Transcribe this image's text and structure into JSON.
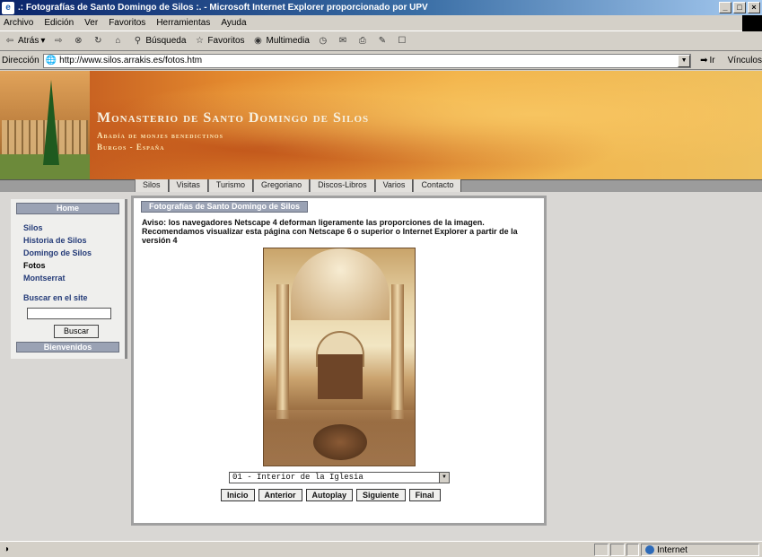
{
  "window": {
    "title": ".: Fotografías de Santo Domingo de Silos :. - Microsoft Internet Explorer proporcionado por UPV",
    "controls": [
      "_",
      "□",
      "×"
    ]
  },
  "menu": [
    "Archivo",
    "Edición",
    "Ver",
    "Favoritos",
    "Herramientas",
    "Ayuda"
  ],
  "toolbar": {
    "back": "Atrás",
    "search": "Búsqueda",
    "favorites": "Favoritos",
    "multimedia": "Multimedia"
  },
  "address": {
    "label": "Dirección",
    "url": "http://www.silos.arrakis.es/fotos.htm",
    "go": "Ir",
    "links": "Vínculos"
  },
  "banner": {
    "title": "Monasterio de Santo Domingo de Silos",
    "subtitle1": "Abadía de monjes benedictinos",
    "subtitle2": "Burgos - España"
  },
  "nav": [
    "Silos",
    "Visitas",
    "Turismo",
    "Gregoriano",
    "Discos-Libros",
    "Varios",
    "Contacto"
  ],
  "sidebar": {
    "home": "Home",
    "links": [
      "Silos",
      "Historia de Silos",
      "Domingo de Silos",
      "Fotos",
      "Montserrat"
    ],
    "active": "Fotos",
    "search_label": "Buscar en el site",
    "search_value": "",
    "search_button": "Buscar",
    "welcome": "Bienvenidos"
  },
  "content": {
    "tab": "Fotografías de Santo Domingo de Silos",
    "notice": "Aviso: los navegadores Netscape 4 deforman ligeramente las proporciones de la imagen. Recomendamos visualizar esta página con Netscape 6 o superior o Internet Explorer a partir de la versión 4",
    "photo_select": "01 - Interior de la Iglesia",
    "buttons": [
      "Inicio",
      "Anterior",
      "Autoplay",
      "Siguiente",
      "Final"
    ]
  },
  "status": {
    "zone": "Internet"
  }
}
